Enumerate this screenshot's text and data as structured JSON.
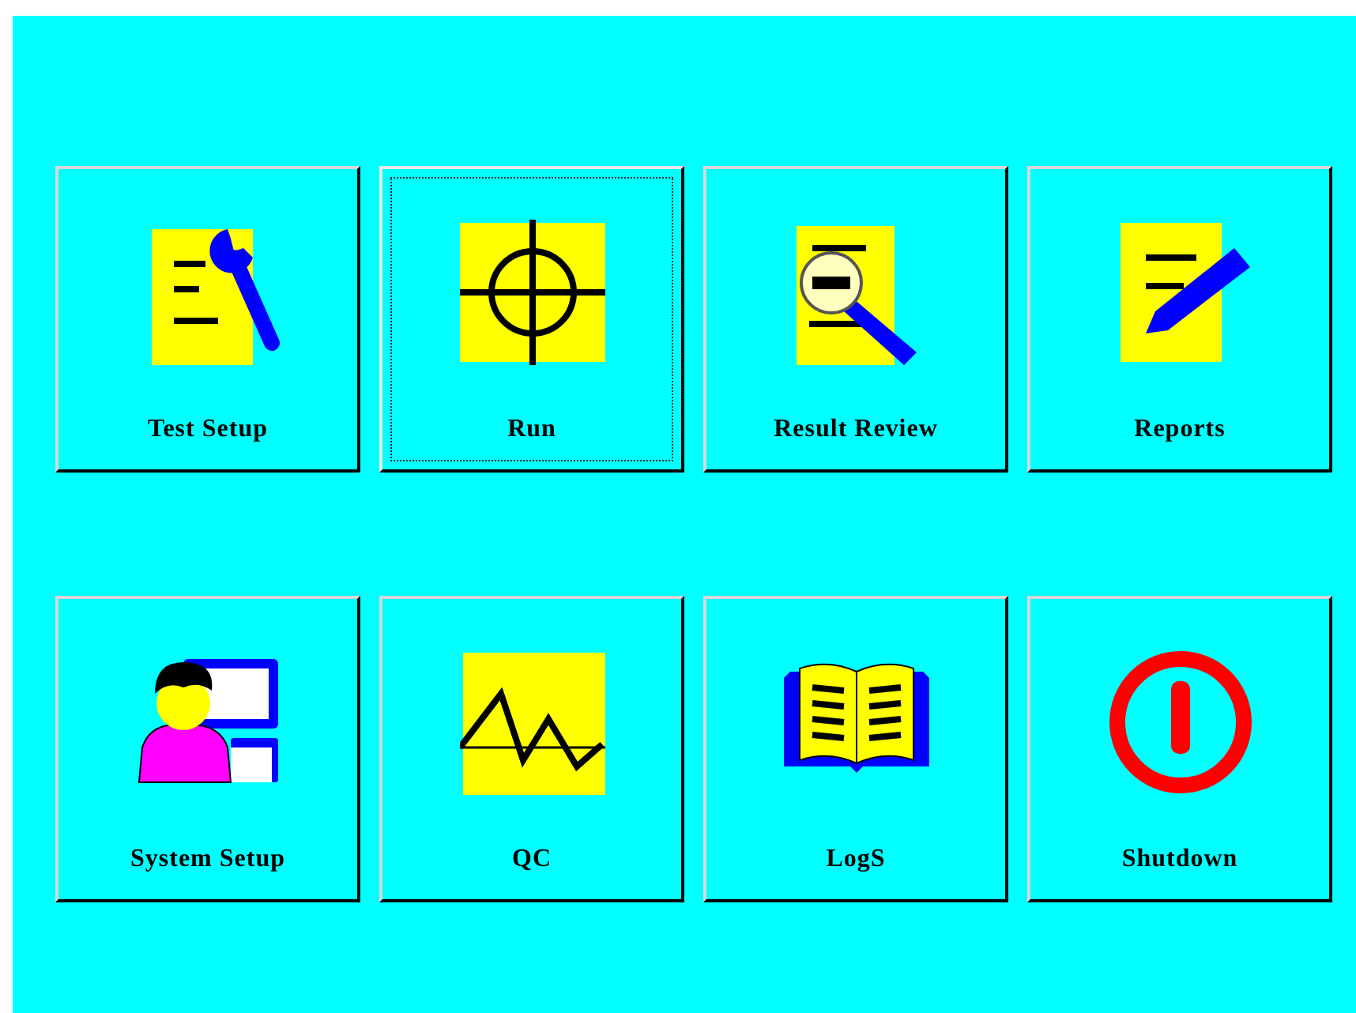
{
  "buttons": [
    {
      "label": "Test Setup",
      "selected": false
    },
    {
      "label": "Run",
      "selected": true
    },
    {
      "label": "Result Review",
      "selected": false
    },
    {
      "label": "Reports",
      "selected": false
    },
    {
      "label": "System Setup",
      "selected": false
    },
    {
      "label": "QC",
      "selected": false
    },
    {
      "label": "LogS",
      "selected": false
    },
    {
      "label": "Shutdown",
      "selected": false
    }
  ]
}
